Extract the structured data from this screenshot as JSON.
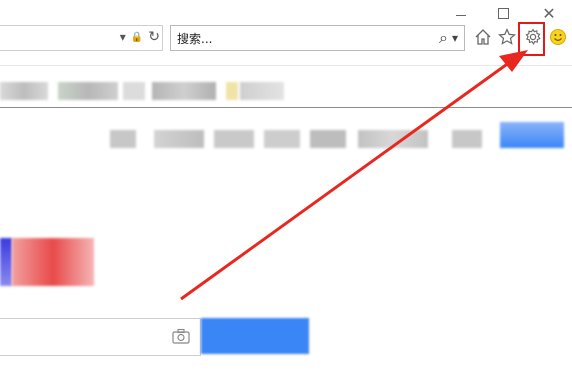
{
  "window": {
    "minimize_icon": "minimize-icon",
    "maximize_icon": "maximize-icon",
    "close_icon": "close-icon",
    "close_glyph": "✕"
  },
  "toolbar": {
    "search_placeholder": "搜索...",
    "lock_glyph": "🔒",
    "refresh_glyph": "↻",
    "dropdown_glyph": "▾",
    "search_glyph": "⌕",
    "home_icon": "home-icon",
    "favorites_icon": "star-icon",
    "tools_icon": "gear-icon",
    "feedback_icon": "smiley-icon"
  },
  "annotation": {
    "highlight_color": "#e11b1b",
    "arrow_color": "#e8281f"
  },
  "page": {
    "search_button_color": "#3b86f7"
  }
}
